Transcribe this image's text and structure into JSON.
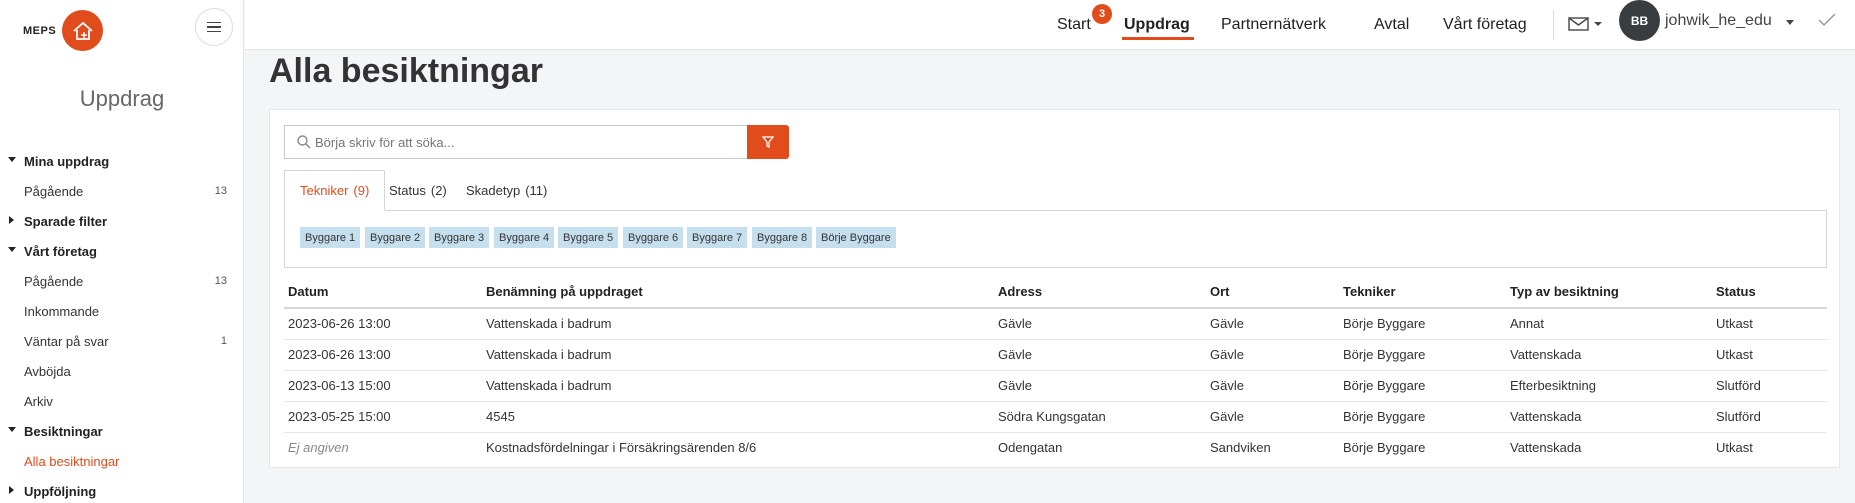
{
  "brand": {
    "logo_text": "MEPS"
  },
  "sidebar": {
    "title": "Uppdrag",
    "items": [
      {
        "type": "group",
        "label": "Mina uppdrag",
        "expanded": true
      },
      {
        "type": "item",
        "label": "Pågående",
        "count": "13"
      },
      {
        "type": "group",
        "label": "Sparade filter",
        "expanded": false
      },
      {
        "type": "group",
        "label": "Vårt företag",
        "expanded": true
      },
      {
        "type": "item",
        "label": "Pågående",
        "count": "13"
      },
      {
        "type": "item",
        "label": "Inkommande",
        "count": ""
      },
      {
        "type": "item",
        "label": "Väntar på svar",
        "count": "1"
      },
      {
        "type": "item",
        "label": "Avböjda",
        "count": ""
      },
      {
        "type": "item",
        "label": "Arkiv",
        "count": ""
      },
      {
        "type": "group",
        "label": "Besiktningar",
        "expanded": true
      },
      {
        "type": "item",
        "label": "Alla besiktningar",
        "count": "",
        "active": true
      },
      {
        "type": "group",
        "label": "Uppföljning",
        "expanded": false
      }
    ]
  },
  "topbar": {
    "nav": [
      {
        "label": "Start",
        "badge": "3"
      },
      {
        "label": "Uppdrag",
        "active": true
      },
      {
        "label": "Partnernätverk"
      },
      {
        "label": "Avtal"
      },
      {
        "label": "Vårt företag"
      }
    ],
    "avatar_initials": "BB",
    "username": "johwik_he_edu"
  },
  "main": {
    "title": "Alla besiktningar",
    "search_placeholder": "Börja skriv för att söka...",
    "tabs": [
      {
        "label": "Tekniker",
        "count": "(9)",
        "active": true
      },
      {
        "label": "Status",
        "count": "(2)"
      },
      {
        "label": "Skadetyp",
        "count": "(11)"
      }
    ],
    "chips": [
      "Byggare 1",
      "Byggare 2",
      "Byggare 3",
      "Byggare 4",
      "Byggare 5",
      "Byggare 6",
      "Byggare 7",
      "Byggare 8",
      "Börje Byggare"
    ],
    "table": {
      "columns": [
        "Datum",
        "Benämning på uppdraget",
        "Adress",
        "Ort",
        "Tekniker",
        "Typ av besiktning",
        "Status"
      ],
      "rows": [
        [
          "2023-06-26 13:00",
          "Vattenskada i badrum",
          "Gävle",
          "Gävle",
          "Börje Byggare",
          "Annat",
          "Utkast"
        ],
        [
          "2023-06-26 13:00",
          "Vattenskada i badrum",
          "Gävle",
          "Gävle",
          "Börje Byggare",
          "Vattenskada",
          "Utkast"
        ],
        [
          "2023-06-13 15:00",
          "Vattenskada i badrum",
          "Gävle",
          "Gävle",
          "Börje Byggare",
          "Efterbesiktning",
          "Slutförd"
        ],
        [
          "2023-05-25 15:00",
          "4545",
          "Södra Kungsgatan",
          "Gävle",
          "Börje Byggare",
          "Vattenskada",
          "Slutförd"
        ],
        [
          "Ej angiven",
          "Kostnadsfördelningar i Försäkringsärenden 8/6",
          "Odengatan",
          "Sandviken",
          "Börje Byggare",
          "Vattenskada",
          "Utkast"
        ]
      ]
    }
  }
}
